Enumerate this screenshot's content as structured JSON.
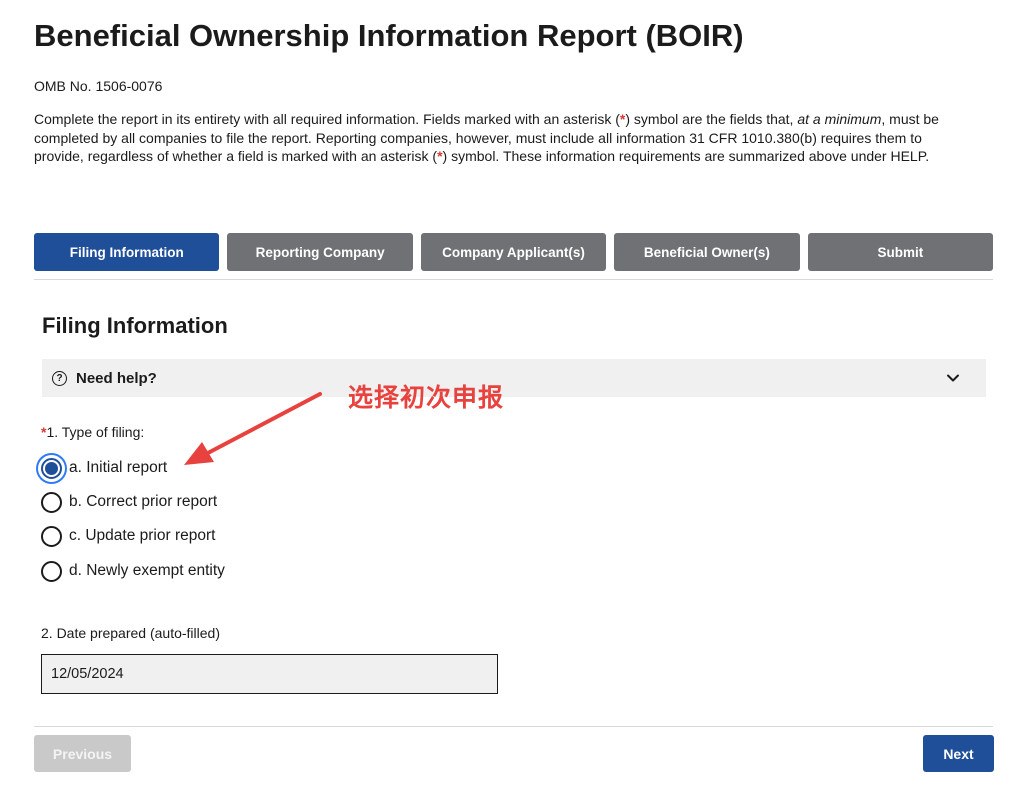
{
  "header": {
    "title": "Beneficial Ownership Information Report (BOIR)",
    "omb": "OMB No. 1506-0076",
    "intro": {
      "p1": "Complete the report in its entirety with all required information. Fields marked with an asterisk (",
      "asterisk1": "*",
      "p2": ") symbol are the fields that, ",
      "emphasis": "at a minimum",
      "p3": ", must be completed by all companies to file the report. Reporting companies, however, must include all information 31 CFR 1010.380(b) requires them to provide, regardless of whether a field is marked with an asterisk (",
      "asterisk2": "*",
      "p4": ") symbol. These information requirements are summarized above under HELP."
    }
  },
  "steps": [
    {
      "label": "Filing Information",
      "active": true
    },
    {
      "label": "Reporting Company",
      "active": false
    },
    {
      "label": "Company Applicant(s)",
      "active": false
    },
    {
      "label": "Beneficial Owner(s)",
      "active": false
    },
    {
      "label": "Submit",
      "active": false
    }
  ],
  "section": {
    "title": "Filing Information",
    "help": {
      "icon": "question-circle-icon",
      "label": "Need help?",
      "toggle_icon": "chevron-down-icon"
    }
  },
  "annotation": {
    "text": "选择初次申报",
    "color": "#e8423f"
  },
  "filing_type": {
    "required_mark": "*",
    "label": "1. Type of filing:",
    "options": [
      {
        "label": "a. Initial report",
        "checked": true
      },
      {
        "label": "b. Correct prior report",
        "checked": false
      },
      {
        "label": "c. Update prior report",
        "checked": false
      },
      {
        "label": "d. Newly exempt entity",
        "checked": false
      }
    ]
  },
  "date_prepared": {
    "label": "2. Date prepared (auto-filled)",
    "value": "12/05/2024"
  },
  "nav": {
    "previous_label": "Previous",
    "next_label": "Next"
  },
  "colors": {
    "primary": "#1f4f99",
    "inactive_step": "#6f7175",
    "required": "#d83933",
    "annotation": "#e8423f"
  }
}
